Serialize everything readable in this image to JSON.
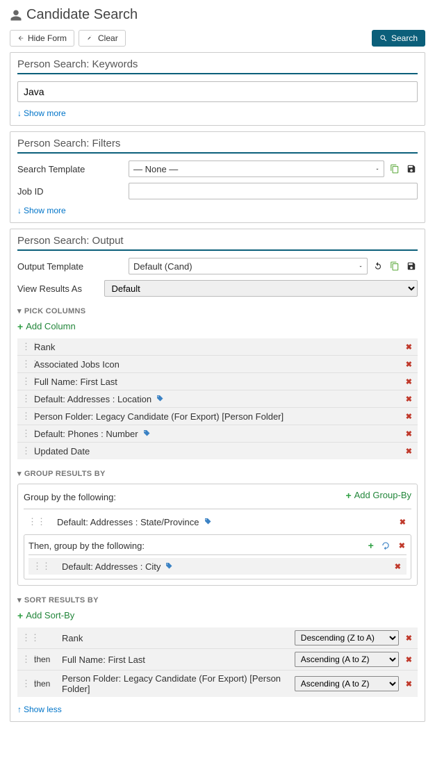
{
  "page": {
    "title": "Candidate Search"
  },
  "toolbar": {
    "hide_form": "Hide Form",
    "clear": "Clear",
    "search": "Search"
  },
  "keywords": {
    "panel_title": "Person Search: Keywords",
    "value": "Java",
    "show_more": "Show more"
  },
  "filters": {
    "panel_title": "Person Search: Filters",
    "search_template_label": "Search Template",
    "search_template_value": "— None —",
    "job_id_label": "Job ID",
    "job_id_value": "",
    "show_more": "Show more"
  },
  "output": {
    "panel_title": "Person Search: Output",
    "output_template_label": "Output Template",
    "output_template_value": "Default (Cand)",
    "view_results_label": "View Results As",
    "view_results_value": "Default",
    "pick_columns_title": "PICK COLUMNS",
    "add_column": "Add Column",
    "columns": [
      {
        "label": "Rank",
        "has_tag_icon": false
      },
      {
        "label": "Associated Jobs Icon",
        "has_tag_icon": false
      },
      {
        "label": "Full Name: First Last",
        "has_tag_icon": false
      },
      {
        "label": "Default: Addresses : Location",
        "has_tag_icon": true
      },
      {
        "label": "Person Folder: Legacy Candidate (For Export) [Person Folder]",
        "has_tag_icon": false
      },
      {
        "label": "Default: Phones : Number",
        "has_tag_icon": true
      },
      {
        "label": "Updated Date",
        "has_tag_icon": false
      }
    ],
    "group_results_title": "GROUP RESULTS BY",
    "group_by_label": "Group by the following:",
    "add_group_by": "Add Group-By",
    "group_by_value": "Default: Addresses : State/Province",
    "then_group_by_label": "Then, group by the following:",
    "then_group_by_value": "Default: Addresses : City",
    "sort_results_title": "SORT RESULTS BY",
    "add_sort_by": "Add Sort-By",
    "sort_rows": [
      {
        "then": "",
        "name": "Rank",
        "direction": "Descending (Z to A)"
      },
      {
        "then": "then",
        "name": "Full Name: First Last",
        "direction": "Ascending (A to Z)"
      },
      {
        "then": "then",
        "name": "Person Folder: Legacy Candidate (For Export) [Person Folder]",
        "direction": "Ascending (A to Z)"
      }
    ],
    "show_less": "Show less"
  }
}
